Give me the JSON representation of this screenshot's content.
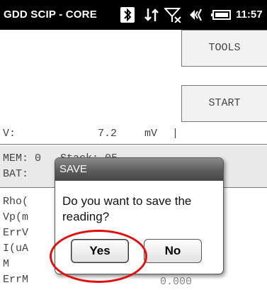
{
  "status_bar": {
    "title": "GDD SCIP - CORE",
    "time": "11:57",
    "icons": [
      "bluetooth-icon",
      "data-transfer-icon",
      "no-signal-icon",
      "volume-muted-icon",
      "battery-icon"
    ]
  },
  "toolbar": {
    "tools_label": "TOOLS",
    "start_label": "START"
  },
  "voltage": {
    "label": "V:",
    "value": "7.2",
    "unit": "mV",
    "cursor": "|"
  },
  "status_panel": {
    "mem_text": "MEM: 0   Stack: 05",
    "bat_text": "BAT:"
  },
  "readings": {
    "rows": [
      "Rho(",
      "Vp(m",
      "ErrV",
      "I(uA",
      "M",
      "ErrM"
    ],
    "errm_value": "0.000"
  },
  "dialog": {
    "title": "SAVE",
    "message": "Do you want to save the reading?",
    "yes_label": "Yes",
    "no_label": "No"
  },
  "colors": {
    "status_bar_bg": "#000000",
    "highlight_ring": "#e01010",
    "panel_bg": "#e9e9e9"
  }
}
